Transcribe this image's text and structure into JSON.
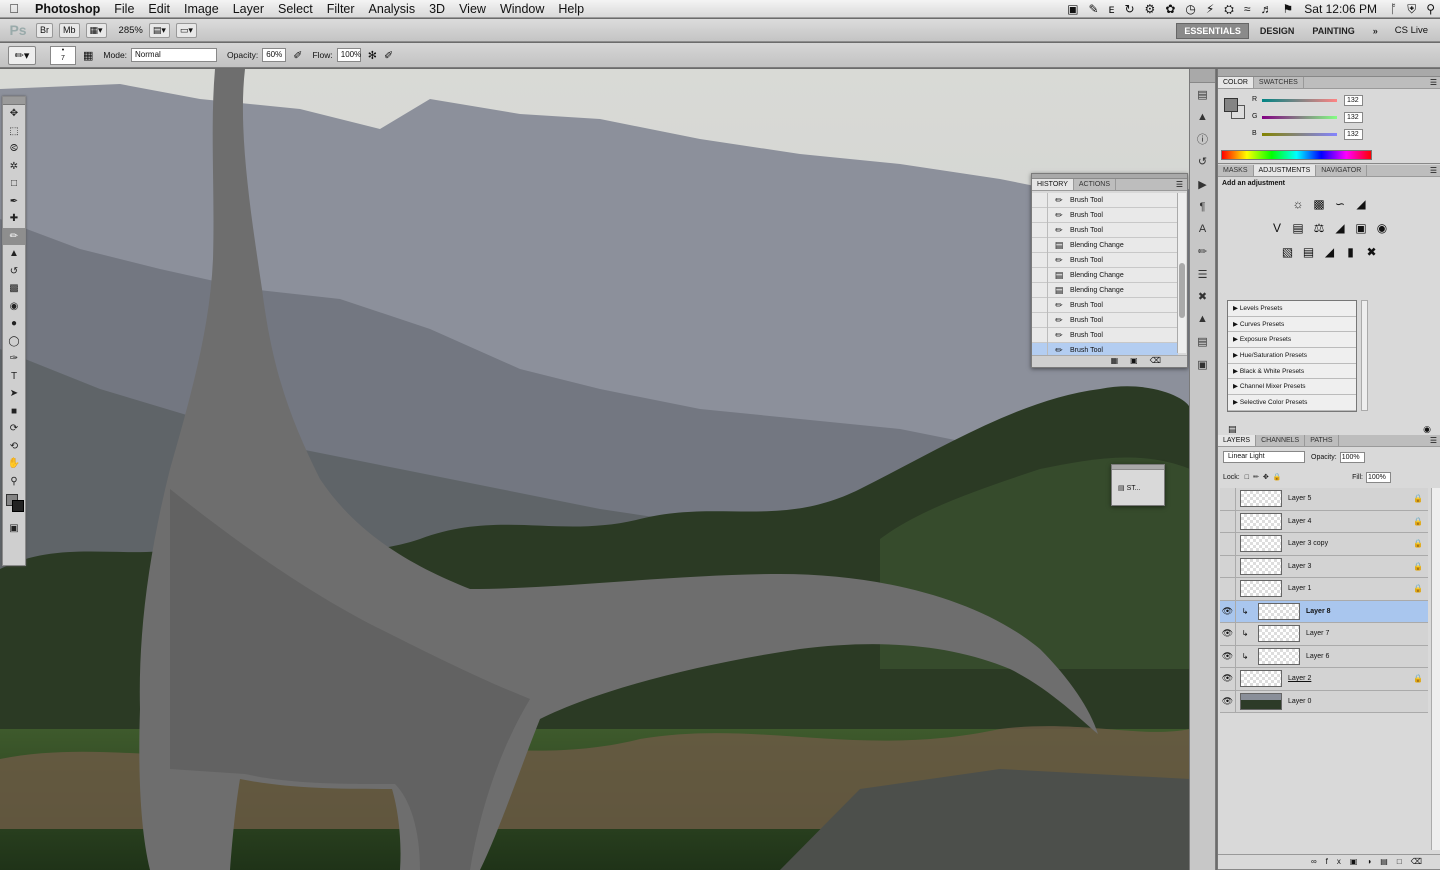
{
  "menubar": {
    "app_name": "Photoshop",
    "menus": [
      "File",
      "Edit",
      "Image",
      "Layer",
      "Select",
      "Filter",
      "Analysis",
      "3D",
      "View",
      "Window",
      "Help"
    ],
    "clock": "Sat 12:06 PM"
  },
  "appbar": {
    "logo": "Ps",
    "zoom": "285%",
    "workspaces": [
      "ESSENTIALS",
      "DESIGN",
      "PAINTING"
    ],
    "overflow": "»",
    "cs_live": "CS Live"
  },
  "options": {
    "brush_size": "7",
    "mode_label": "Mode:",
    "mode_value": "Normal",
    "opacity_label": "Opacity:",
    "opacity_value": "60%",
    "flow_label": "Flow:",
    "flow_value": "100%"
  },
  "history": {
    "tabs": [
      "HISTORY",
      "ACTIONS"
    ],
    "items": [
      "Brush Tool",
      "Brush Tool",
      "Brush Tool",
      "Blending Change",
      "Brush Tool",
      "Blending Change",
      "Blending Change",
      "Brush Tool",
      "Brush Tool",
      "Brush Tool",
      "Brush Tool"
    ]
  },
  "mini_panel": {
    "label": "ST..."
  },
  "color_panel": {
    "tabs": [
      "COLOR",
      "SWATCHES"
    ],
    "channels": [
      {
        "name": "R",
        "value": "132"
      },
      {
        "name": "G",
        "value": "132"
      },
      {
        "name": "B",
        "value": "132"
      }
    ]
  },
  "adjustments": {
    "tabs": [
      "MASKS",
      "ADJUSTMENTS",
      "NAVIGATOR"
    ],
    "title": "Add an adjustment",
    "presets": [
      "Levels Presets",
      "Curves Presets",
      "Exposure Presets",
      "Hue/Saturation Presets",
      "Black & White Presets",
      "Channel Mixer Presets",
      "Selective Color Presets"
    ]
  },
  "layers": {
    "tabs": [
      "LAYERS",
      "CHANNELS",
      "PATHS"
    ],
    "blend_mode": "Linear Light",
    "opacity_label": "Opacity:",
    "opacity_value": "100%",
    "lock_label": "Lock:",
    "fill_label": "Fill:",
    "fill_value": "100%",
    "items": [
      {
        "name": "Layer 5"
      },
      {
        "name": "Layer 4"
      },
      {
        "name": "Layer 3 copy"
      },
      {
        "name": "Layer 3"
      },
      {
        "name": "Layer 1"
      },
      {
        "name": "Layer 8"
      },
      {
        "name": "Layer 7"
      },
      {
        "name": "Layer 6"
      },
      {
        "name": "Layer 2"
      },
      {
        "name": "Layer 0"
      }
    ]
  }
}
